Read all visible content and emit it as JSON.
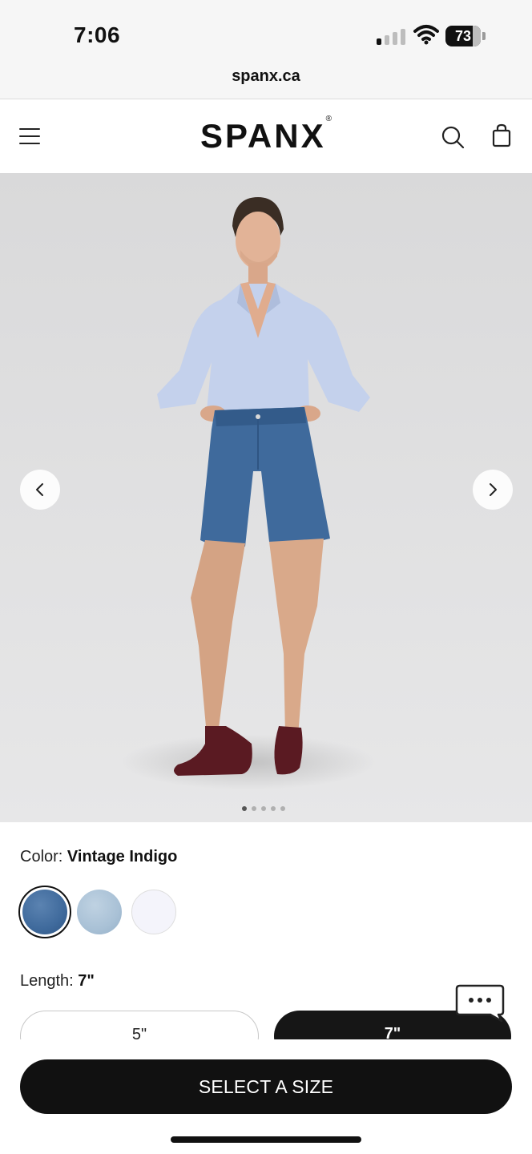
{
  "status_bar": {
    "time": "7:06",
    "battery": "73",
    "url": "spanx.ca"
  },
  "header": {
    "logo": "SPANX",
    "logo_mark": "®"
  },
  "colors": {
    "denim_vintage": "#3f6a9c",
    "denim_light": "#a9c1d6",
    "white_swatch": "#f4f4fb",
    "cta_bg": "#111111"
  },
  "carousel": {
    "image_count": 5,
    "active_index": 0
  },
  "product": {
    "color_label": "Color:",
    "color_value": "Vintage Indigo",
    "swatches": [
      {
        "name": "Vintage Indigo",
        "selected": true
      },
      {
        "name": "Light Wash",
        "selected": false
      },
      {
        "name": "White",
        "selected": false
      }
    ],
    "length_label": "Length:",
    "length_value": "7\"",
    "length_options": [
      {
        "label": "5\"",
        "selected": false
      },
      {
        "label": "7\"",
        "selected": true
      }
    ]
  },
  "cta": {
    "label": "SELECT A SIZE"
  },
  "icons": [
    "menu-icon",
    "search-icon",
    "bag-icon",
    "chevron-left-icon",
    "chevron-right-icon",
    "chat-icon"
  ]
}
